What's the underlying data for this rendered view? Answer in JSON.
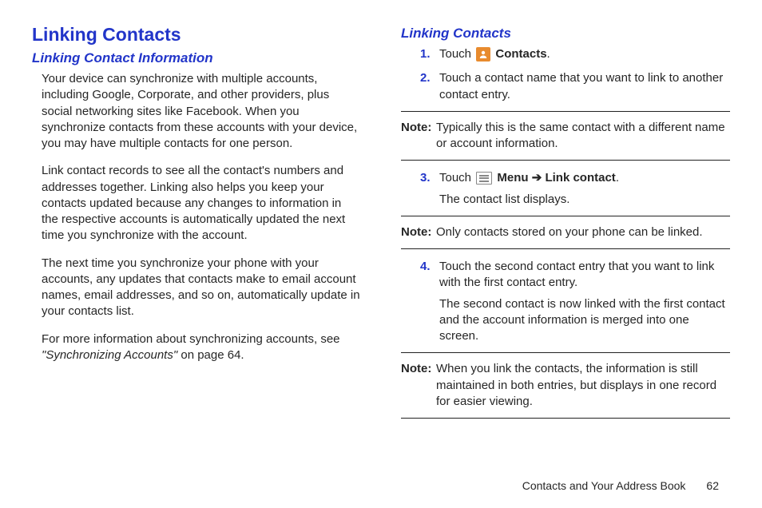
{
  "left": {
    "heading1": "Linking Contacts",
    "heading2": "Linking Contact Information",
    "p1": "Your device can synchronize with multiple accounts, including Google, Corporate, and other providers, plus social networking sites like Facebook. When you synchronize contacts from these accounts with your device, you may have multiple contacts for one person.",
    "p2": "Link contact records to see all the contact's numbers and addresses together. Linking also helps you keep your contacts updated because any changes to information in the respective accounts is automatically updated the next time you synchronize with the account.",
    "p3": "The next time you synchronize your phone with your accounts, any updates that contacts make to email account names, email addresses, and so on, automatically update in your contacts list.",
    "p4a": "For more information about synchronizing accounts, see ",
    "p4b": "\"Synchronizing Accounts\"",
    "p4c": " on page 64."
  },
  "right": {
    "heading2": "Linking Contacts",
    "step1_num": "1.",
    "step1_a": "Touch ",
    "step1_b": " Contacts",
    "step1_c": ".",
    "step2_num": "2.",
    "step2": "Touch a contact name that you want to link to another contact entry.",
    "note1_label": "Note:",
    "note1_text": "Typically this is the same contact with a different name or account information.",
    "step3_num": "3.",
    "step3_a": "Touch ",
    "step3_b": " Menu",
    "step3_arrow": " ➔ ",
    "step3_c": "Link contact",
    "step3_d": ".",
    "step3_sub": "The contact list displays.",
    "note2_label": "Note:",
    "note2_text": "Only contacts stored on your phone can be linked.",
    "step4_num": "4.",
    "step4": "Touch the second contact entry that you want to link with the first contact entry.",
    "step4_sub": "The second contact is now linked with the first contact and the account information is merged into one screen.",
    "note3_label": "Note:",
    "note3_text": "When you link the contacts, the information is still maintained in both entries, but displays in one record for easier viewing."
  },
  "footer": {
    "section": "Contacts and Your Address Book",
    "page": "62"
  }
}
